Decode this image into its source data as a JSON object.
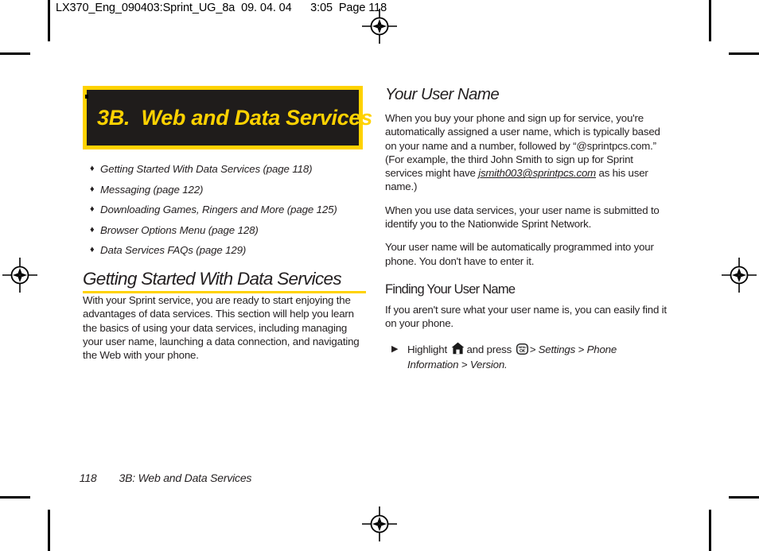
{
  "slug": "LX370_Eng_090403:Sprint_UG_8a  09. 04. 04      3:05  Page 118",
  "chapter": {
    "banner_title": "3B.  Web and Data Services"
  },
  "toc": {
    "bullet_glyph": "♦",
    "items": [
      {
        "label": "Getting Started With Data Services (page 118)"
      },
      {
        "label": "Messaging (page 122)"
      },
      {
        "label": "Downloading Games, Ringers and More (page 125)"
      },
      {
        "label": "Browser Options Menu (page 128)"
      },
      {
        "label": "Data Services FAQs (page 129)"
      }
    ]
  },
  "left_column": {
    "heading": "Getting Started With Data Services",
    "paragraph": "With your Sprint service, you are ready to start enjoying the advantages of data services. This section will help you learn the basics of using your data services, including managing your user name, launching a data connection, and navigating the Web with your phone."
  },
  "right_column": {
    "heading": "Your User Name",
    "paragraph_1_before_link": "When you buy your phone and sign up for service, you're automatically assigned a user name, which is typically based on your name and a number, followed by “@sprintpcs.com.” (For example, the third John Smith to sign up for Sprint services might have ",
    "paragraph_1_link": "jsmith003@sprintpcs.com",
    "paragraph_1_after_link": " as his user name.)",
    "paragraph_2": "When you use data services, your user name is submitted to identify you to the Nationwide Sprint Network.",
    "paragraph_3": "Your user name will be automatically programmed into your phone. You don't have to enter it.",
    "subheading": "Finding Your User Name",
    "paragraph_4": "If you aren't sure what your user name is, you can easily find it on your phone.",
    "step": {
      "arrow_glyph": "▶",
      "text_1": "Highlight",
      "home_icon": "home-key-icon",
      "text_2": "and press",
      "ok_icon": "menu-ok-key-icon",
      "ok_icon_top_label": "MENU",
      "ok_icon_bottom_label": "OK",
      "path": "> Settings > Phone Information > Version."
    }
  },
  "footer": {
    "page_number": "118",
    "chapter_title": "3B: Web and Data Services"
  },
  "colors": {
    "accent_yellow": "#ffd200",
    "banner_background": "#1f1c1b",
    "text": "#231f20"
  }
}
